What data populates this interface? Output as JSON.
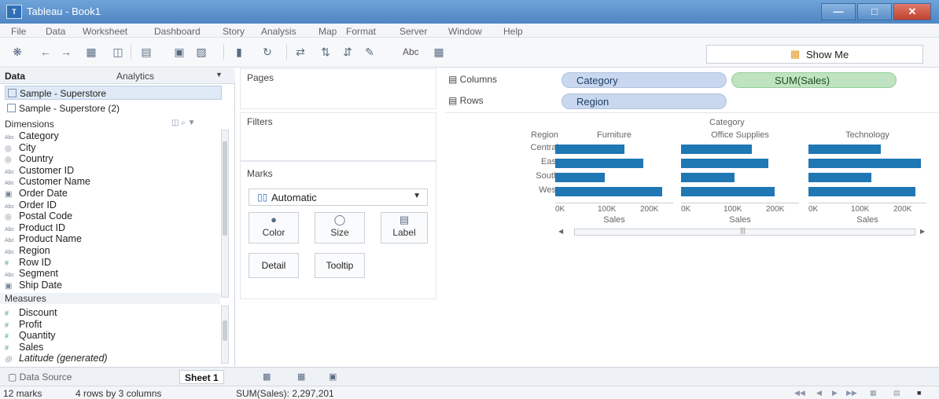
{
  "window": {
    "title": "Tableau - Book1",
    "logo_text": "T"
  },
  "menu": [
    "File",
    "Data",
    "Worksheet",
    "Dashboard",
    "Story",
    "Analysis",
    "Map",
    "Format",
    "Server",
    "Window",
    "Help"
  ],
  "toolbar": {
    "abc_label": "Abc",
    "show_me_label": "Show Me"
  },
  "left_pane": {
    "tab_data": "Data",
    "tab_analytics": "Analytics",
    "datasources": [
      "Sample - Superstore",
      "Sample - Superstore (2)"
    ],
    "dimensions_header": "Dimensions",
    "dimensions": [
      {
        "type": "Abc",
        "name": "Category"
      },
      {
        "type": "geo",
        "name": "City"
      },
      {
        "type": "geo",
        "name": "Country"
      },
      {
        "type": "Abc",
        "name": "Customer ID"
      },
      {
        "type": "Abc",
        "name": "Customer Name"
      },
      {
        "type": "date",
        "name": "Order Date"
      },
      {
        "type": "Abc",
        "name": "Order ID"
      },
      {
        "type": "geo",
        "name": "Postal Code"
      },
      {
        "type": "Abc",
        "name": "Product ID"
      },
      {
        "type": "Abc",
        "name": "Product Name"
      },
      {
        "type": "Abc",
        "name": "Region"
      },
      {
        "type": "num",
        "name": "Row ID"
      },
      {
        "type": "Abc",
        "name": "Segment"
      },
      {
        "type": "date",
        "name": "Ship Date"
      }
    ],
    "measures_header": "Measures",
    "measures": [
      {
        "type": "num",
        "name": "Discount"
      },
      {
        "type": "num",
        "name": "Profit"
      },
      {
        "type": "num",
        "name": "Quantity"
      },
      {
        "type": "num",
        "name": "Sales"
      },
      {
        "type": "geo",
        "name": "Latitude (generated)"
      }
    ]
  },
  "cards": {
    "pages": "Pages",
    "filters": "Filters",
    "marks": "Marks",
    "mark_type": "Automatic",
    "mark_buttons": [
      "Color",
      "Size",
      "Label",
      "Detail",
      "Tooltip"
    ]
  },
  "shelves": {
    "columns_label": "Columns",
    "rows_label": "Rows",
    "columns_pills": [
      "Category",
      "SUM(Sales)"
    ],
    "rows_pills": [
      "Region"
    ]
  },
  "chart_data": {
    "type": "bar",
    "title": "",
    "header_label": "Category",
    "row_header": "Region",
    "categories": [
      "Central",
      "East",
      "South",
      "West"
    ],
    "panels": [
      {
        "name": "Furniture",
        "values": [
          163797,
          208291,
          117299,
          252613
        ]
      },
      {
        "name": "Office Supplies",
        "values": [
          167026,
          205516,
          125651,
          220853
        ]
      },
      {
        "name": "Technology",
        "values": [
          170416,
          264974,
          148772,
          251992
        ]
      }
    ],
    "xlabel": "Sales",
    "ticks": [
      "0K",
      "100K",
      "200K"
    ],
    "xlim": [
      0,
      250000
    ]
  },
  "sheetbar": {
    "data_source": "Data Source",
    "sheet": "Sheet 1"
  },
  "status": {
    "marks": "12 marks",
    "dims": "4 rows by 3 columns",
    "sum": "SUM(Sales): 2,297,201"
  }
}
